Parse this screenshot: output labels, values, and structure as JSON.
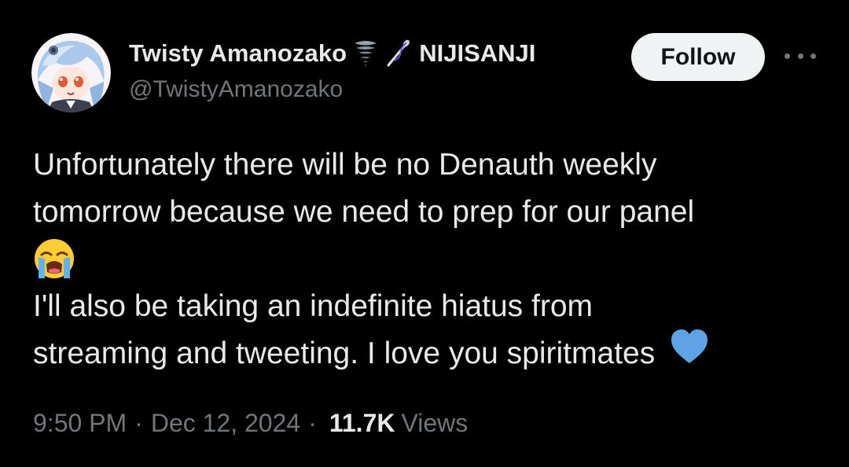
{
  "author": {
    "display_name": "Twisty Amanozako",
    "affiliation": "NIJISANJI",
    "handle": "@TwistyAmanozako",
    "icons": [
      "tornado-icon",
      "needle-icon"
    ]
  },
  "actions": {
    "follow_label": "Follow",
    "more_icon": "more-horizontal-icon"
  },
  "tweet": {
    "lines": [
      "Unfortunately there will be no Denauth weekly",
      "tomorrow because we need to prep for our panel",
      "I'll also be taking an indefinite hiatus from",
      "streaming and tweeting. I love you spiritmates"
    ],
    "emojis": [
      "loudly-crying-face-emoji",
      "blue-heart-emoji"
    ]
  },
  "meta": {
    "time": "9:50 PM",
    "date": "Dec 12, 2024",
    "separator": "·",
    "views_count": "11.7K",
    "views_label": "Views"
  },
  "colors": {
    "background": "#000000",
    "text_primary": "#e7e9ea",
    "text_secondary": "#71767b",
    "follow_bg": "#eff3f4",
    "heart": "#5da3e6"
  }
}
